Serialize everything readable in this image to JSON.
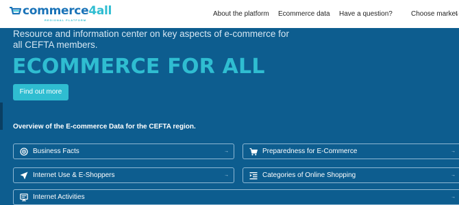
{
  "header": {
    "logo_main": "commerce",
    "logo_accent": "4all",
    "logo_sub": "REGIONAL PLATFORM",
    "nav": {
      "about": "About the platform",
      "ecommerce_data": "Ecommerce data",
      "question": "Have a question?",
      "choose_market": "Choose market"
    }
  },
  "hero": {
    "tagline": "Resource and information center on key aspects of e-commerce for all CEFTA members.",
    "title": "ECOMMERCE FOR ALL",
    "cta": "Find out more"
  },
  "overview": {
    "title": "Overview of the E-commerce Data for the CEFTA region.",
    "cards": [
      {
        "label": "Business Facts",
        "icon": "target-icon"
      },
      {
        "label": "Preparedness for E-Commerce",
        "icon": "cart-icon"
      },
      {
        "label": "Internet Use & E-Shoppers",
        "icon": "send-icon"
      },
      {
        "label": "Categories of Online Shopping",
        "icon": "list-icon"
      },
      {
        "label": "Internet Activities",
        "icon": "monitor-icon"
      }
    ],
    "arrow": "→"
  },
  "colors": {
    "background": "#0d5d8f",
    "accent": "#2fbdd1",
    "logo_blue": "#1a73b8"
  }
}
